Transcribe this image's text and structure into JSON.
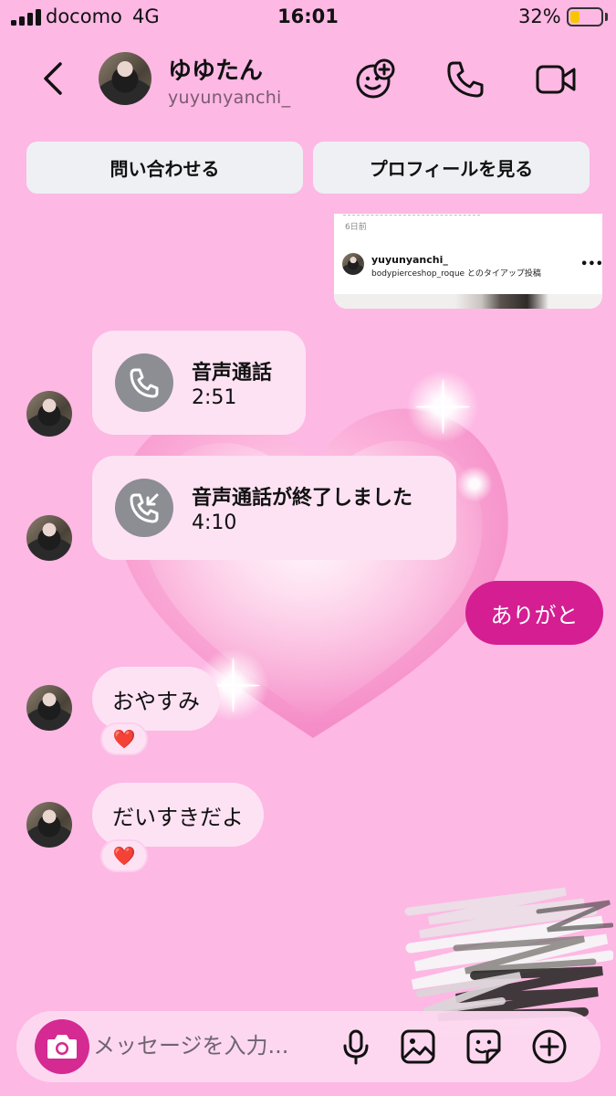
{
  "status_bar": {
    "carrier": "docomo",
    "network": "4G",
    "time": "16:01",
    "battery_percent": "32%",
    "battery_level": 0.32
  },
  "header": {
    "name": "ゆゆたん",
    "username": "yuyunyanchi_"
  },
  "actions": {
    "contact_label": "問い合わせる",
    "view_profile_label": "プロフィールを見る"
  },
  "shared_post": {
    "time_ago": "6日前",
    "username": "yuyunyanchi_",
    "caption": "bodypierceshop_roque とのタイアップ投稿"
  },
  "messages": [
    {
      "type": "call",
      "title": "音声通話",
      "duration": "2:51",
      "icon": "phone-icon"
    },
    {
      "type": "call",
      "title": "音声通話が終了しました",
      "duration": "4:10",
      "icon": "missed-call-icon"
    },
    {
      "type": "text",
      "direction": "outgoing",
      "text": "ありがと"
    },
    {
      "type": "text",
      "direction": "incoming",
      "text": "おやすみ",
      "reaction": "❤️"
    },
    {
      "type": "text",
      "direction": "incoming",
      "text": "だいすきだよ",
      "reaction": "❤️"
    }
  ],
  "composer": {
    "placeholder": "メッセージを入力..."
  },
  "colors": {
    "background": "#fdb8e4",
    "bubble_incoming": "#fde2f4",
    "bubble_outgoing": "#d41e92",
    "action_button": "#eef0f4"
  }
}
